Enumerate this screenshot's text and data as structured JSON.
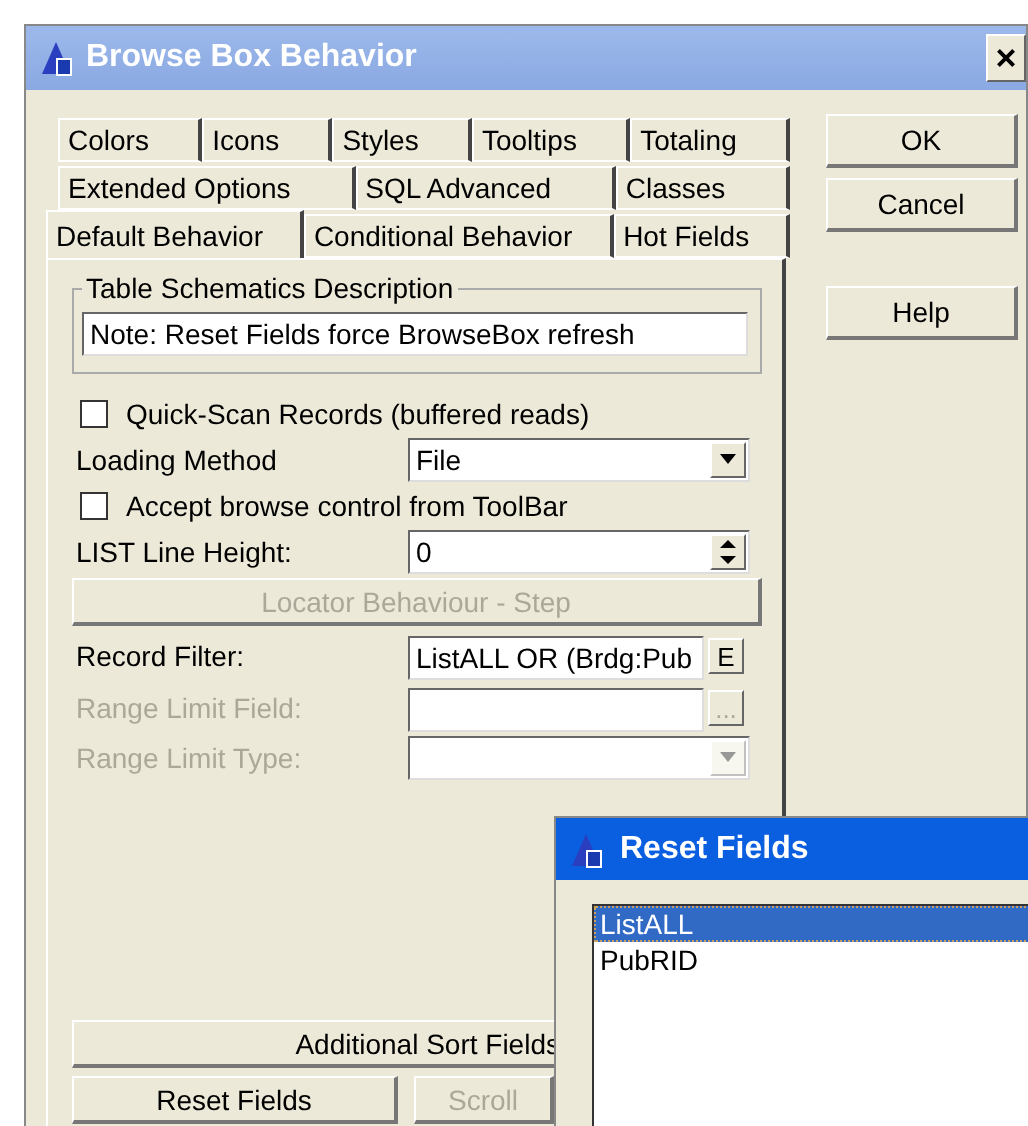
{
  "window": {
    "title": "Browse Box Behavior",
    "close": "×"
  },
  "tab_rows": [
    [
      {
        "label": "Colors",
        "selected": false
      },
      {
        "label": "Icons",
        "selected": false
      },
      {
        "label": "Styles",
        "selected": false
      },
      {
        "label": "Tooltips",
        "selected": false
      },
      {
        "label": "Totaling",
        "selected": false
      }
    ],
    [
      {
        "label": "Extended Options",
        "selected": false
      },
      {
        "label": "SQL Advanced",
        "selected": false
      },
      {
        "label": "Classes",
        "selected": false
      }
    ],
    [
      {
        "label": "Default Behavior",
        "selected": true
      },
      {
        "label": "Conditional Behavior",
        "selected": false
      },
      {
        "label": "Hot Fields",
        "selected": false
      }
    ]
  ],
  "side_buttons": [
    "OK",
    "Cancel",
    "Help"
  ],
  "group": {
    "title": "Table Schematics Description",
    "value": "Note: Reset Fields force BrowseBox refresh"
  },
  "controls": [
    {
      "kind": "checkbox",
      "label": "Quick-Scan Records (buffered reads)",
      "checked": false,
      "disabled": false
    },
    {
      "kind": "select",
      "label": "Loading Method",
      "value": "File",
      "disabled": false
    },
    {
      "kind": "checkbox",
      "label": "Accept browse control from ToolBar",
      "checked": false,
      "disabled": false
    },
    {
      "kind": "spin",
      "label": "LIST Line Height:",
      "value": "0",
      "disabled": false
    },
    {
      "kind": "button",
      "label": "Locator Behaviour - Step",
      "disabled": true
    },
    {
      "kind": "lookup",
      "label": "Record Filter:",
      "value": "ListALL OR (Brdg:Pub",
      "button": "E",
      "disabled": false
    },
    {
      "kind": "lookup",
      "label": "Range Limit Field:",
      "button": "...",
      "disabled": true
    },
    {
      "kind": "select",
      "label": "Range Limit Type:",
      "disabled": true
    }
  ],
  "bottom_buttons": [
    {
      "label": "Additional Sort Fields",
      "disabled": false
    },
    {
      "label": "Reset Fields",
      "disabled": false
    },
    {
      "label": "Scroll",
      "disabled": true
    }
  ],
  "popup": {
    "title": "Reset Fields",
    "items": [
      {
        "label": "ListALL",
        "selected": true
      },
      {
        "label": "PubRID",
        "selected": false
      }
    ]
  }
}
